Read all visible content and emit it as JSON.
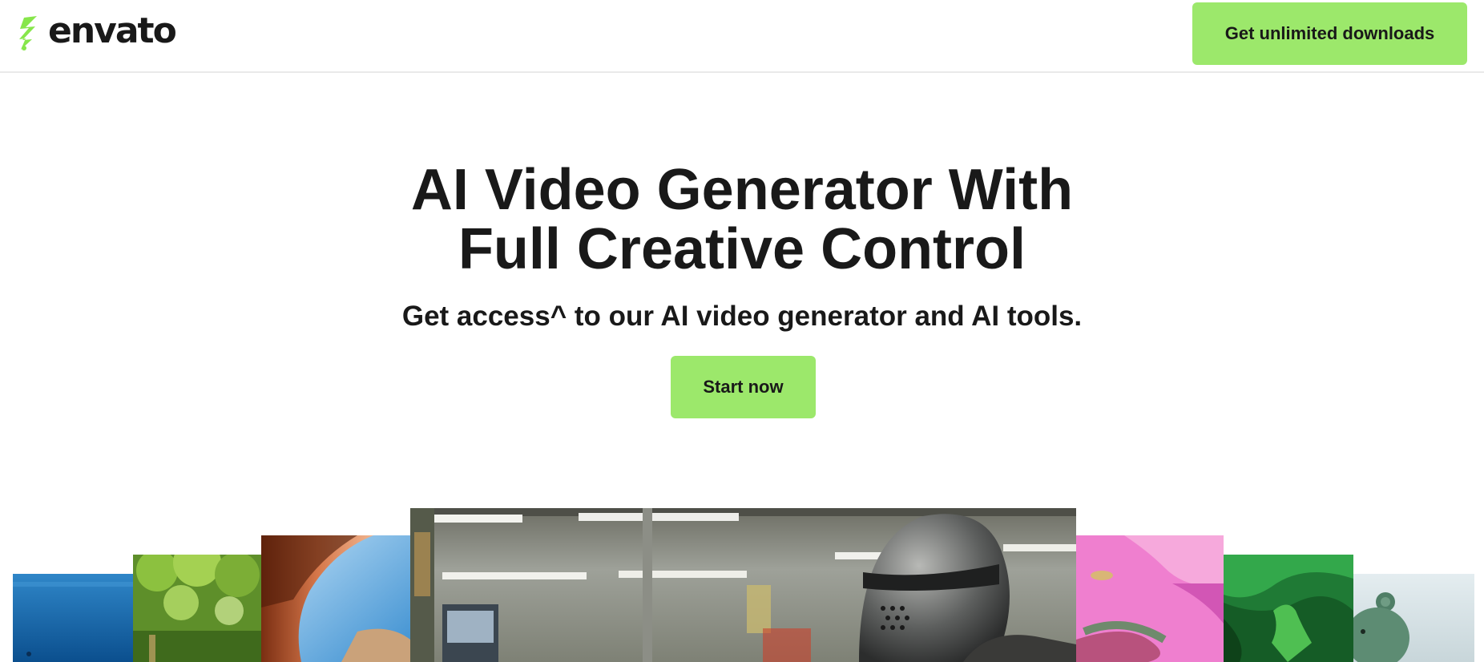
{
  "header": {
    "logo_text": "envato",
    "cta_label": "Get unlimited downloads"
  },
  "hero": {
    "title_line1": "AI Video Generator With",
    "title_line2": "Full Creative Control",
    "subtitle": "Get access^ to our AI video generator and AI tools.",
    "start_label": "Start now"
  },
  "colors": {
    "accent": "#9ce86b",
    "text": "#191919",
    "logo_green": "#87e64b"
  },
  "gallery": [
    {
      "name": "ocean-underwater",
      "icon": "video-thumbnail"
    },
    {
      "name": "forest-bokeh",
      "icon": "video-thumbnail"
    },
    {
      "name": "desert-rock-arch",
      "icon": "video-thumbnail"
    },
    {
      "name": "knight-in-supermarket",
      "icon": "video-thumbnail"
    },
    {
      "name": "pink-surreal-snake",
      "icon": "video-thumbnail"
    },
    {
      "name": "green-paper-tree",
      "icon": "video-thumbnail"
    },
    {
      "name": "toy-bear",
      "icon": "video-thumbnail"
    }
  ]
}
